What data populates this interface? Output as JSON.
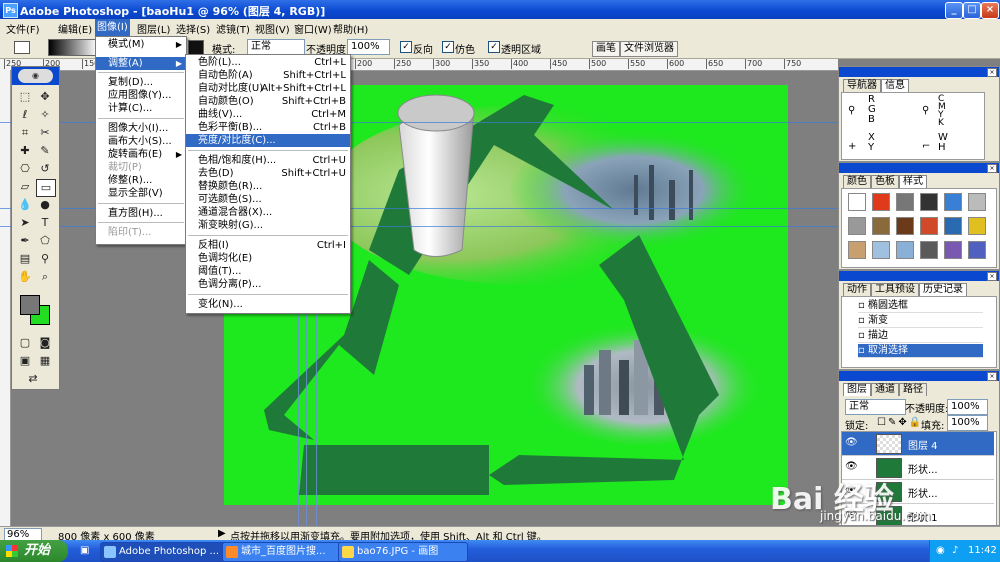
{
  "window": {
    "title": "Adobe Photoshop - [baoHu1 @ 96% (图层 4, RGB)]",
    "controls": [
      "_",
      "□",
      "×"
    ]
  },
  "menubar": {
    "items": [
      "文件(F)",
      "编辑(E)",
      "图像(I)",
      "图层(L)",
      "选择(S)",
      "滤镜(T)",
      "视图(V)",
      "窗口(W)",
      "帮助(H)"
    ],
    "active": "图像(I)"
  },
  "options": {
    "mode_label": "模式:",
    "mode_value": "正常",
    "opacity_label": "不透明度:",
    "opacity_value": "100%",
    "reverse": "反向",
    "dither": "仿色",
    "transparency": "透明区域",
    "tab_brush": "画笔",
    "tab_browser": "文件浏览器"
  },
  "ruler": {
    "ticks": [
      "250",
      "200",
      "150",
      "100",
      "50",
      "0",
      "50",
      "100",
      "150",
      "200",
      "250",
      "300",
      "350",
      "400",
      "450",
      "500",
      "550",
      "600",
      "650",
      "700",
      "750"
    ]
  },
  "image_menu": {
    "items": [
      {
        "label": "模式(M)",
        "sub": true
      },
      {
        "label": "调整(A)",
        "sub": true,
        "hl": true
      },
      {
        "label": "复制(D)..."
      },
      {
        "label": "应用图像(Y)..."
      },
      {
        "label": "计算(C)..."
      },
      {
        "label": "图像大小(I)..."
      },
      {
        "label": "画布大小(S)..."
      },
      {
        "label": "旋转画布(E)",
        "sub": true
      },
      {
        "label": "裁切(P)",
        "dis": true
      },
      {
        "label": "修整(R)..."
      },
      {
        "label": "显示全部(V)"
      },
      {
        "label": "直方图(H)..."
      },
      {
        "label": "陷印(T)...",
        "dis": true
      }
    ]
  },
  "adjust_menu": {
    "items": [
      {
        "label": "色阶(L)...",
        "sc": "Ctrl+L"
      },
      {
        "label": "自动色阶(A)",
        "sc": "Shift+Ctrl+L"
      },
      {
        "label": "自动对比度(U)",
        "sc": "Alt+Shift+Ctrl+L"
      },
      {
        "label": "自动颜色(O)",
        "sc": "Shift+Ctrl+B"
      },
      {
        "label": "曲线(V)...",
        "sc": "Ctrl+M"
      },
      {
        "label": "色彩平衡(B)...",
        "sc": "Ctrl+B"
      },
      {
        "label": "亮度/对比度(C)...",
        "sc": "",
        "hl": true
      },
      {
        "label": "色相/饱和度(H)...",
        "sc": "Ctrl+U"
      },
      {
        "label": "去色(D)",
        "sc": "Shift+Ctrl+U"
      },
      {
        "label": "替换颜色(R)...",
        "sc": ""
      },
      {
        "label": "可选颜色(S)...",
        "sc": ""
      },
      {
        "label": "通道混合器(X)...",
        "sc": ""
      },
      {
        "label": "渐变映射(G)...",
        "sc": ""
      },
      {
        "label": "反相(I)",
        "sc": "Ctrl+I"
      },
      {
        "label": "色调均化(E)",
        "sc": ""
      },
      {
        "label": "阈值(T)...",
        "sc": ""
      },
      {
        "label": "色调分离(P)...",
        "sc": ""
      },
      {
        "label": "变化(N)...",
        "sc": ""
      }
    ]
  },
  "nav_panel": {
    "tabs": [
      "导航器",
      "信息"
    ],
    "rgb": "R\nG\nB",
    "cmyk": "C\nM\nY\nK",
    "xy": "X\nY",
    "wh": "W\nH"
  },
  "color_panel": {
    "tabs": [
      "颜色",
      "色板",
      "样式"
    ]
  },
  "history_panel": {
    "tabs": [
      "动作",
      "工具预设",
      "历史记录"
    ],
    "rows": [
      {
        "label": "椭圆选框"
      },
      {
        "label": "渐变"
      },
      {
        "label": "描边"
      },
      {
        "label": "取消选择",
        "sel": true
      }
    ]
  },
  "layers_panel": {
    "tabs": [
      "图层",
      "通道",
      "路径"
    ],
    "blend": "正常",
    "opacity_label": "不透明度:",
    "opacity": "100%",
    "lock_label": "锁定:",
    "fill_label": "填充:",
    "fill": "100%",
    "layers": [
      {
        "name": "图层 4",
        "sel": true
      },
      {
        "name": "形状..."
      },
      {
        "name": "形状..."
      },
      {
        "name": "形状 1"
      }
    ]
  },
  "status": {
    "zoom": "96%",
    "size": "800 像素 x 600 像素",
    "hint": "点按并拖移以用渐变填充。要用附加选项，使用 Shift、Alt 和 Ctrl 键。"
  },
  "taskbar": {
    "start": "开始",
    "tasks": [
      "Adobe Photoshop ...",
      "城市_百度图片搜...",
      "bao76.JPG - 画图"
    ],
    "time": "11:42"
  },
  "watermark": {
    "text": "Bai 经验",
    "url": "jingyan.baidu.com"
  },
  "colors": {
    "canvas": "#1ee81e",
    "recycle": "#1f7a3a",
    "menu_highlight": "#316ac5",
    "title": "#0a48d0"
  }
}
